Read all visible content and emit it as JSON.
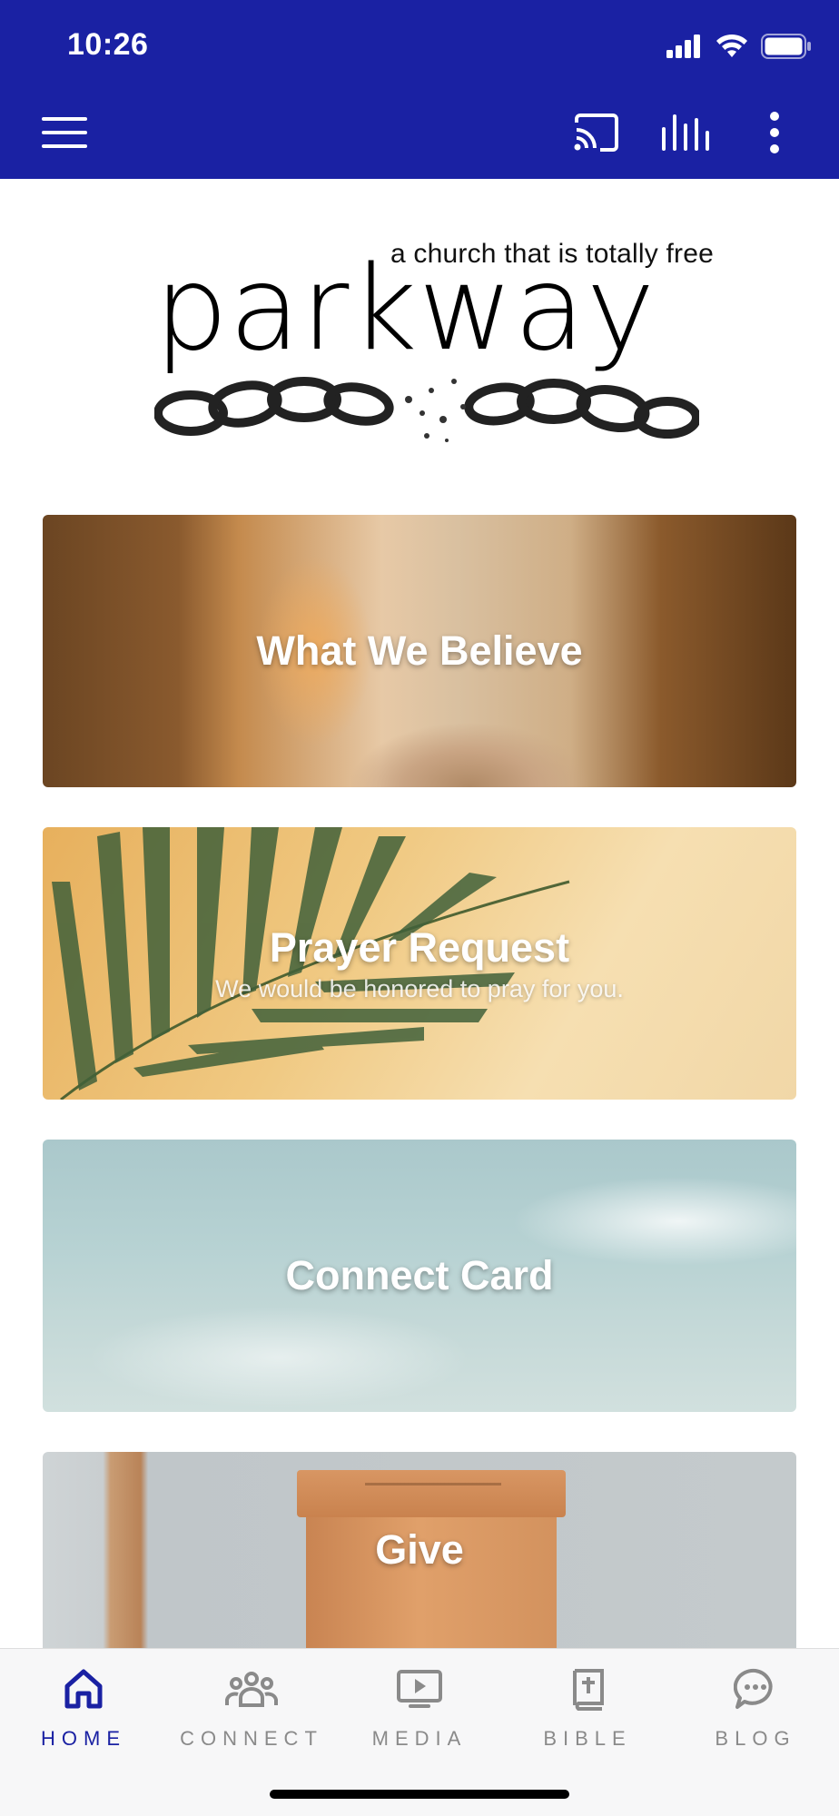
{
  "status_bar": {
    "time": "10:26",
    "icons": [
      "signal-icon",
      "wifi-icon",
      "battery-icon"
    ]
  },
  "app_bar": {
    "background": "#1A21A3",
    "actions": [
      "menu-icon",
      "cast-icon",
      "audio-icon",
      "more-icon"
    ]
  },
  "logo": {
    "tagline": "a church that is totally free",
    "word": "parkway"
  },
  "cards": [
    {
      "title": "What We Believe",
      "subtitle": ""
    },
    {
      "title": "Prayer Request",
      "subtitle": "We would be honored to pray for you."
    },
    {
      "title": "Connect Card",
      "subtitle": ""
    },
    {
      "title": "Give",
      "subtitle": ""
    }
  ],
  "tab_bar": {
    "active_color": "#1A21A3",
    "inactive_color": "#8a8a8a",
    "tabs": [
      {
        "label": "HOME",
        "icon": "home-icon",
        "active": true
      },
      {
        "label": "CONNECT",
        "icon": "people-icon",
        "active": false
      },
      {
        "label": "MEDIA",
        "icon": "media-icon",
        "active": false
      },
      {
        "label": "BIBLE",
        "icon": "bible-icon",
        "active": false
      },
      {
        "label": "BLOG",
        "icon": "chat-icon",
        "active": false
      }
    ]
  }
}
